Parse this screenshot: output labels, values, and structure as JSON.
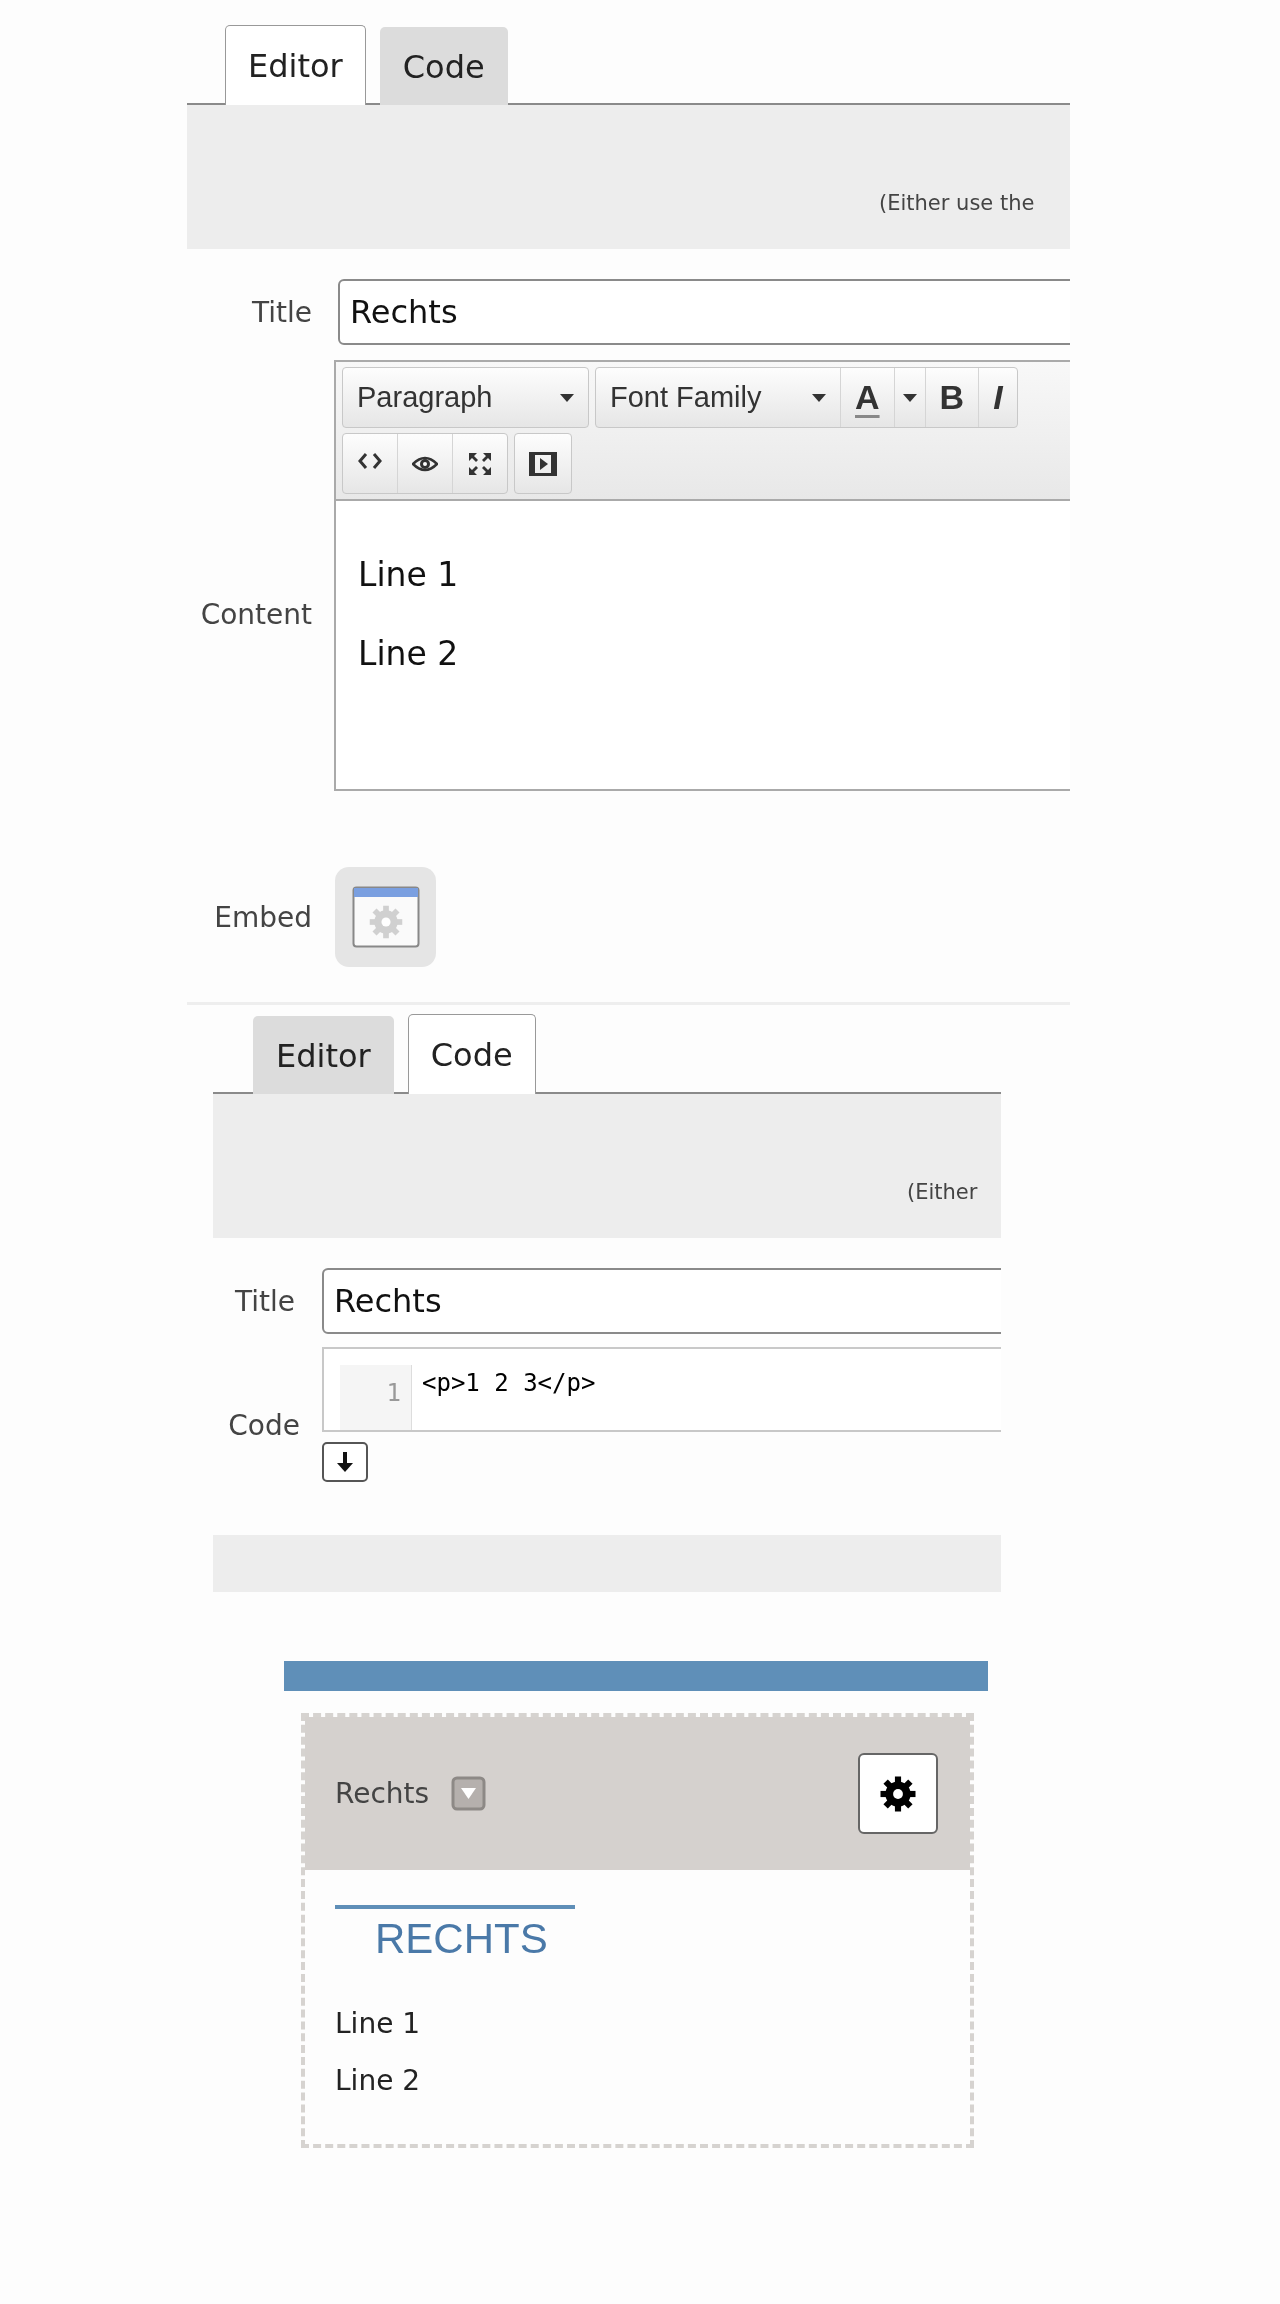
{
  "panels": [
    {
      "kind": "editor",
      "tabs": [
        {
          "label": "Editor",
          "selected": true
        },
        {
          "label": "Code",
          "selected": false
        }
      ],
      "hint": "(Either use the",
      "title_label": "Title",
      "title_value": "Rechts",
      "toolbar": {
        "format": "Paragraph",
        "font": "Font Family",
        "color_glyph": "A",
        "bold_glyph": "B",
        "italic_glyph": "I"
      },
      "content_label": "Content",
      "content": [
        "Line 1",
        "Line 2"
      ],
      "embed_label": "Embed"
    },
    {
      "kind": "code",
      "tabs": [
        {
          "label": "Editor",
          "selected": false
        },
        {
          "label": "Code",
          "selected": true
        }
      ],
      "hint": "(Either",
      "title_label": "Title",
      "title_value": "Rechts",
      "code_label": "Code",
      "code_lines": [
        {
          "number": "1",
          "text": "<p>1 2 3</p>"
        }
      ]
    }
  ],
  "preview": {
    "header_title": "Rechts",
    "heading": "RECHTS",
    "lines": [
      "Line 1",
      "Line 2"
    ]
  }
}
